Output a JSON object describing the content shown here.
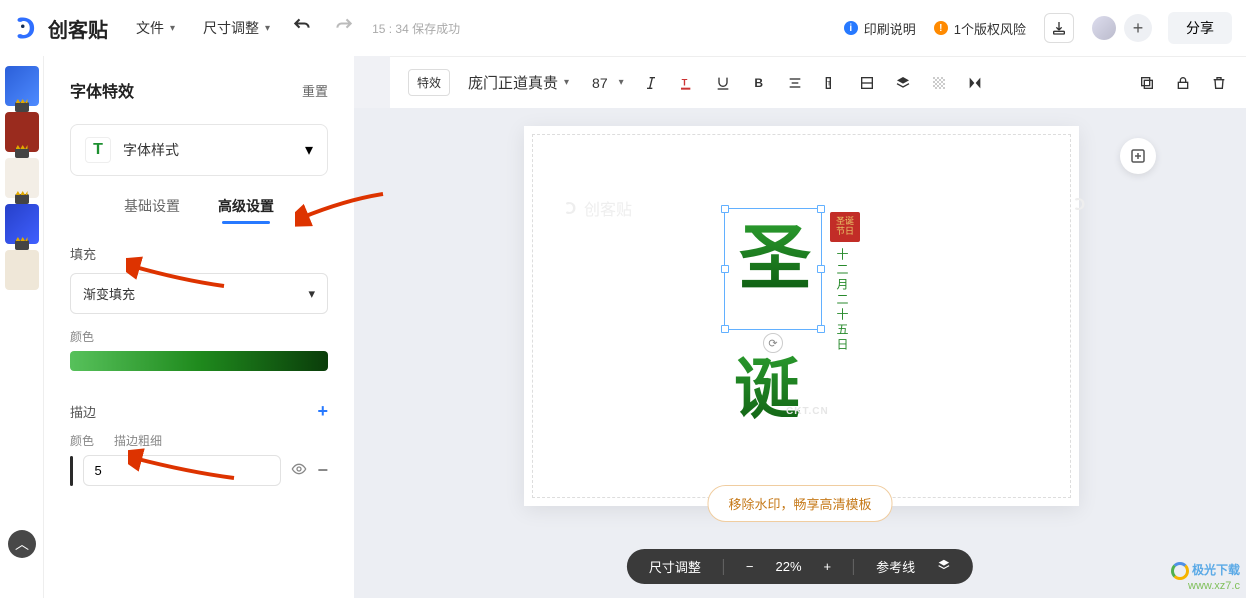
{
  "header": {
    "brand": "创客贴",
    "file_label": "文件",
    "resize_label": "尺寸调整",
    "save_status": "15 : 34 保存成功",
    "print_info": "印刷说明",
    "copyright_warn": "1个版权风险",
    "share_label": "分享"
  },
  "toolbar": {
    "effect_label": "特效",
    "font_name": "庞门正道真贵",
    "font_size": "87"
  },
  "panel": {
    "title": "字体特效",
    "reset": "重置",
    "style_card_label": "字体样式",
    "style_card_icon": "T",
    "tab_basic": "基础设置",
    "tab_advanced": "高级设置",
    "fill_label": "填充",
    "fill_mode": "渐变填充",
    "color_label": "颜色",
    "stroke_label": "描边",
    "stroke_width_label": "描边粗细",
    "stroke_width_value": "5"
  },
  "canvas": {
    "watermark_brand": "创客贴",
    "main_top": "圣",
    "main_bottom": "诞",
    "seal_text": "圣诞\n节日",
    "vertical_date": "十二月二十五日",
    "ckt_mark": "CKT.CN",
    "remove_wm": "移除水印，畅享高清模板"
  },
  "bottombar": {
    "resize": "尺寸调整",
    "zoom": "22%",
    "guides": "参考线"
  },
  "sitemark": {
    "l1": "极光下载",
    "l2": "www.xz7.c"
  }
}
